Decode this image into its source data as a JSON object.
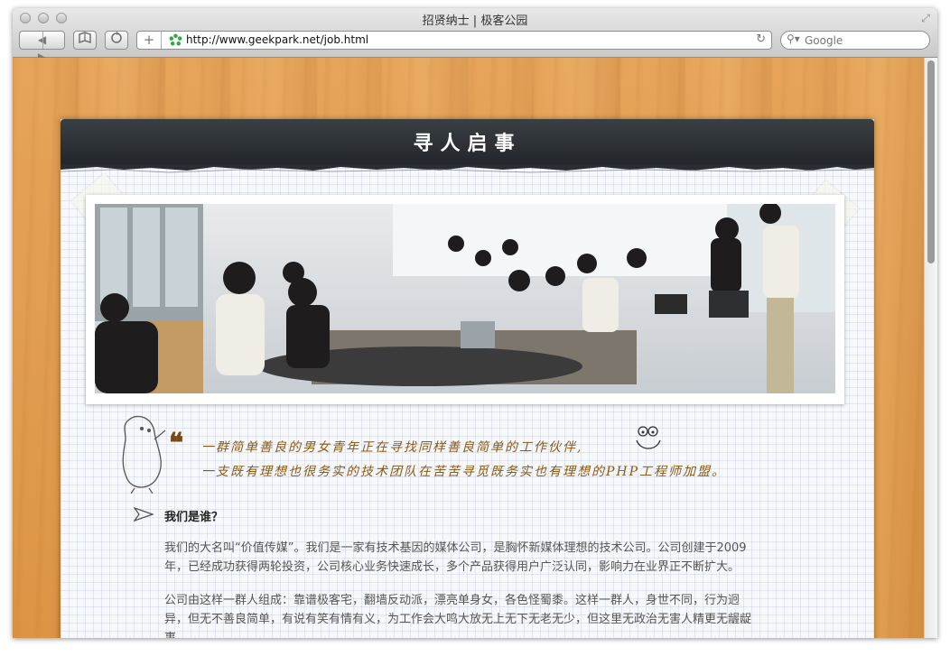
{
  "window": {
    "title": "招贤纳士 | 极客公园",
    "url": "http://www.geekpark.net/job.html",
    "search_placeholder": "Google"
  },
  "toolbar": {
    "back_glyph": "◀",
    "forward_glyph": "▶",
    "add_glyph": "+",
    "reload_glyph": "↻"
  },
  "page": {
    "header_title": "寻人启事",
    "quote": {
      "line1": "一群简单善良的男女青年正在寻找同样善良简单的工作伙伴,",
      "line2": "一支既有理想也很务实的技术团队在苦苦寻觅既务实也有理想的PHP工程师加盟。"
    },
    "section_title": "我们是谁？",
    "paragraph1": "我们的大名叫“价值传媒”。我们是一家有技术基因的媒体公司，是胸怀新媒体理想的技术公司。公司创建于2009年，已经成功获得两轮投资，公司核心业务快速成长，多个产品获得用户广泛认同，影响力在业界正不断扩大。",
    "paragraph2": "公司由这样一群人组成：靠谱极客宅，翻墙反动派，漂亮单身女，各色怪蜀黍。这样一群人，身世不同，行为迥异，但无不善良简单，有说有笑有情有义，为工作会大鸣大放无上无下无老无少，但这里无政治无害人精更无龌龊事。"
  },
  "colors": {
    "header_bg": "#2a2e33",
    "quote_text": "#8a5a12",
    "wood": "#e0a050"
  },
  "icons": {
    "favicon": "geekpark-favicon",
    "arrow": "paper-plane-arrow-icon",
    "smiley": "smiley-doodle-icon",
    "figure": "bean-figure-doodle"
  }
}
